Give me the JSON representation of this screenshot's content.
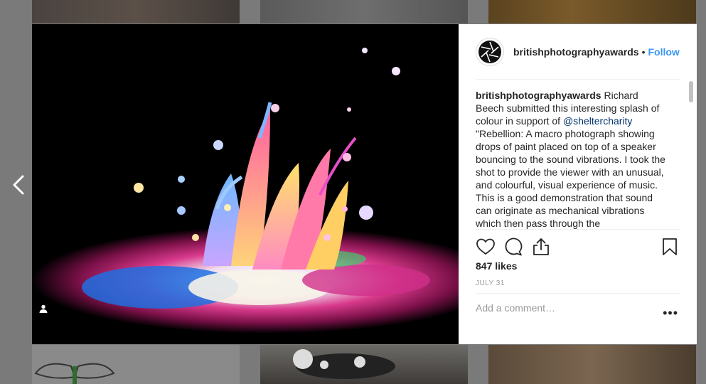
{
  "post": {
    "username": "britishphotographyawards",
    "separator": "•",
    "follow_label": "Follow",
    "caption_username": "britishphotographyawards",
    "caption_text_1": " Richard Beech submitted this interesting splash of colour in support of ",
    "caption_mention": "@sheltercharity",
    "caption_text_2": " \"Rebellion: A macro photograph showing drops of paint placed on top of a speaker bouncing to the sound vibrations. I took the shot to provide the viewer with an unusual, and colourful, visual experience of music. This is a good demonstration that sound can originate as mechanical vibrations which then pass through the",
    "likes": "847 likes",
    "date": "JULY 31",
    "comment_placeholder": "Add a comment…",
    "more_label": "•••"
  },
  "icons": {
    "prev": "chevron-left-icon",
    "like": "heart-icon",
    "comment": "comment-icon",
    "share": "share-icon",
    "save": "bookmark-icon",
    "user_tag": "user-icon",
    "avatar": "aperture-icon"
  },
  "colors": {
    "link": "#3897f0",
    "text": "#262626",
    "muted": "#999999"
  }
}
